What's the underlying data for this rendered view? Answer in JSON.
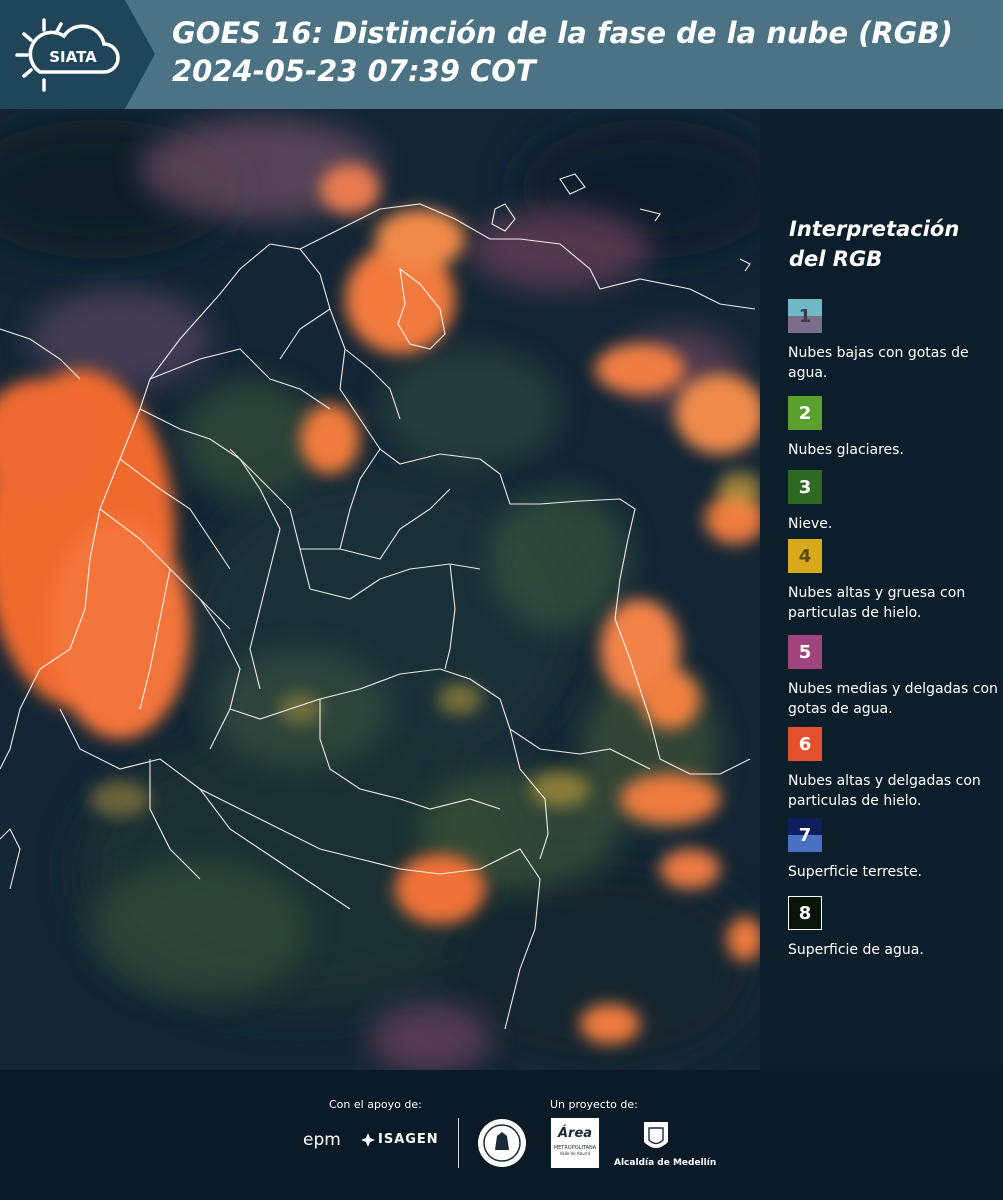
{
  "header": {
    "logo_text": "SIATA",
    "title": "GOES 16: Distinción de la fase de la nube (RGB)\n 2024-05-23 07:39 COT",
    "bg_color": "#4c7383",
    "logo_bg_color": "#1f4558"
  },
  "map": {
    "satellite": "GOES 16",
    "product": "RGB cloud phase distinction",
    "region": "Colombia"
  },
  "legend": {
    "title": "Interpretación del RGB",
    "items": [
      {
        "number": "1",
        "label": "Nubes bajas con gotas de agua.",
        "color_top": "#6fb8c6",
        "color_bottom": "#7a6e8b"
      },
      {
        "number": "2",
        "label": "Nubes glaciares.",
        "color_top": "#5aa02c",
        "color_bottom": "#5aa02c"
      },
      {
        "number": "3",
        "label": "Nieve.",
        "color_top": "#2e6a22",
        "color_bottom": "#2e6a22"
      },
      {
        "number": "4",
        "label": "Nubes altas y gruesa con particulas de hielo.",
        "color_top": "#d8a91a",
        "color_bottom": "#d8a91a"
      },
      {
        "number": "5",
        "label": "Nubes medias y delgadas con gotas de agua.",
        "color_top": "#a0447c",
        "color_bottom": "#a0447c"
      },
      {
        "number": "6",
        "label": "Nubes altas y delgadas con particulas de hielo.",
        "color_top": "#e4502b",
        "color_bottom": "#e4502b"
      },
      {
        "number": "7",
        "label": "Superficie terreste.",
        "color_top": "#0d1f5c",
        "color_bottom": "#4a70c4"
      },
      {
        "number": "8",
        "label": "Superficie de agua.",
        "color_top": "#081408",
        "color_bottom": "#081408"
      }
    ]
  },
  "footer": {
    "support_caption": "Con el apoyo de:",
    "project_caption": "Un proyecto de:",
    "sponsors": [
      "epm",
      "ISAGEN"
    ],
    "project_logo_text": [
      "Área",
      "METROPOLITANA",
      "Valle de Aburrá"
    ],
    "alcaldia_text": "Alcaldía de Medellín"
  }
}
